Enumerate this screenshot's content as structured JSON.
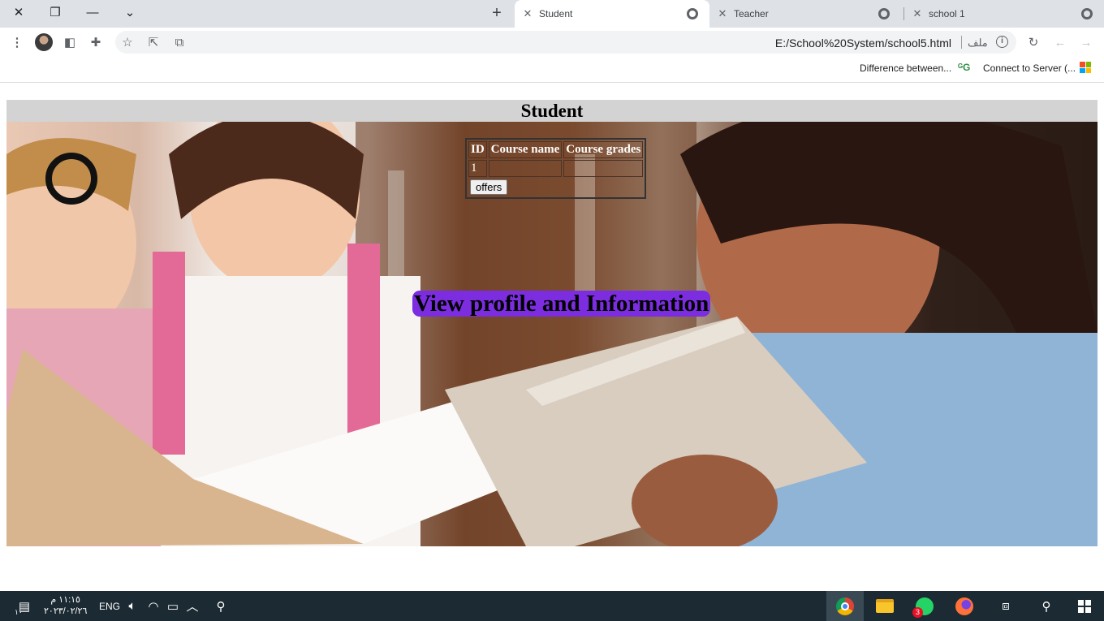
{
  "browser": {
    "tabs": [
      {
        "title": "Student",
        "active": true
      },
      {
        "title": "Teacher",
        "active": false
      },
      {
        "title": "school 1",
        "active": false
      }
    ],
    "new_tab": "+",
    "url": "E:/School%20System/school5.html",
    "scheme_label": "ملف",
    "bookmarks": [
      {
        "label": "Difference between...",
        "icon": "geeksforgeeks-icon"
      },
      {
        "label": "Connect to Server (...",
        "icon": "microsoft-icon"
      }
    ]
  },
  "page": {
    "header": "Student",
    "table": {
      "headers": [
        "ID",
        "Course name",
        "Course grades"
      ],
      "rows": [
        [
          "1",
          "",
          ""
        ]
      ],
      "button_label": "offers"
    },
    "profile_link": "View profile and Information"
  },
  "taskbar": {
    "time": "١١:١٥ م",
    "date": "٢٠٢٣/٠٢/٢٦",
    "language": "ENG",
    "notification_count": "١٠",
    "whatsapp_badge": "3"
  },
  "colors": {
    "header_bg": "#d3d3d3",
    "link_bg": "#7c2de0",
    "taskbar_bg": "#1c2b33"
  }
}
